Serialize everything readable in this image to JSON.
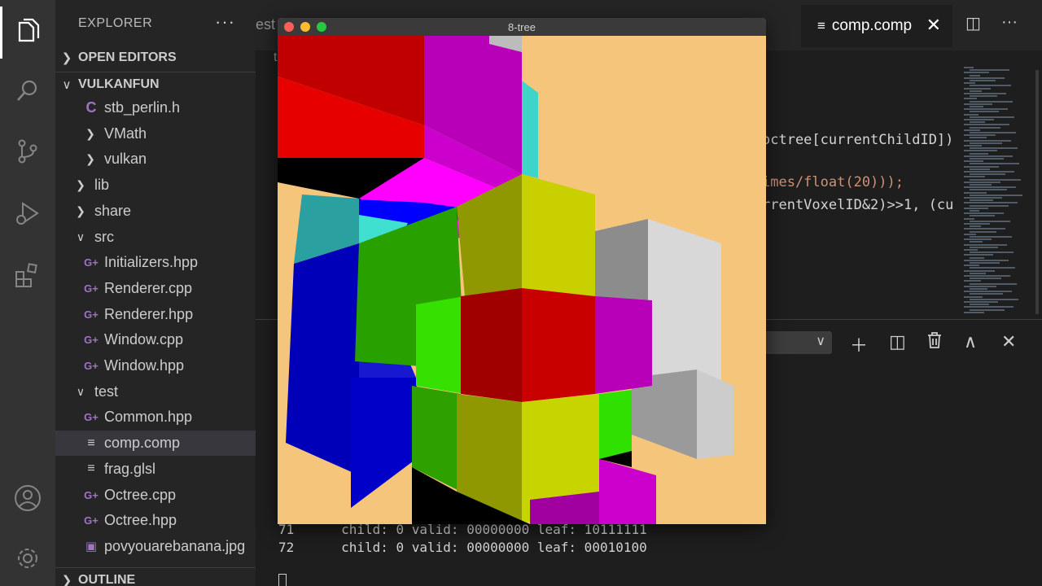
{
  "activity_bar": {
    "icons": [
      "files-icon",
      "search-icon",
      "source-control-icon",
      "run-debug-icon",
      "extensions-icon",
      "account-icon",
      "settings-gear-icon"
    ]
  },
  "sidebar": {
    "title": "EXPLORER",
    "more": "···",
    "sections": {
      "open_editors": "OPEN EDITORS",
      "project": "VULKANFUN",
      "outline": "OUTLINE"
    },
    "tree": [
      {
        "label": "stb_perlin.h",
        "type": "c"
      },
      {
        "label": "VMath",
        "type": "folder"
      },
      {
        "label": "vulkan",
        "type": "folder"
      },
      {
        "label": "lib",
        "type": "folder"
      },
      {
        "label": "share",
        "type": "folder"
      },
      {
        "label": "src",
        "type": "folder-open"
      },
      {
        "label": "Initializers.hpp",
        "type": "cpp"
      },
      {
        "label": "Renderer.cpp",
        "type": "cpp"
      },
      {
        "label": "Renderer.hpp",
        "type": "cpp"
      },
      {
        "label": "Window.cpp",
        "type": "cpp"
      },
      {
        "label": "Window.hpp",
        "type": "cpp"
      },
      {
        "label": "test",
        "type": "folder-open"
      },
      {
        "label": "Common.hpp",
        "type": "cpp"
      },
      {
        "label": "comp.comp",
        "type": "lines"
      },
      {
        "label": "frag.glsl",
        "type": "lines"
      },
      {
        "label": "Octree.cpp",
        "type": "cpp"
      },
      {
        "label": "Octree.hpp",
        "type": "cpp"
      },
      {
        "label": "povyouarebanana.jpg",
        "type": "img"
      }
    ]
  },
  "editor": {
    "partial_tab": "est",
    "active_tab": "comp.comp",
    "breadcrumb": "t",
    "code": [
      "octree[currentChildID])",
      "imes/float(20)));",
      "rrentVoxelID&2)>>1, (cu"
    ]
  },
  "terminal": {
    "lines": [
      {
        "num": "71",
        "text": "child: 0 valid: 00000000 leaf: 10111111"
      },
      {
        "num": "72",
        "text": "child: 0 valid: 00000000 leaf: 00010100"
      }
    ]
  },
  "window": {
    "title": "8-tree",
    "traffic_colors": [
      "#ff5f57",
      "#febc2e",
      "#28c840"
    ],
    "background": "#f4c57a"
  }
}
